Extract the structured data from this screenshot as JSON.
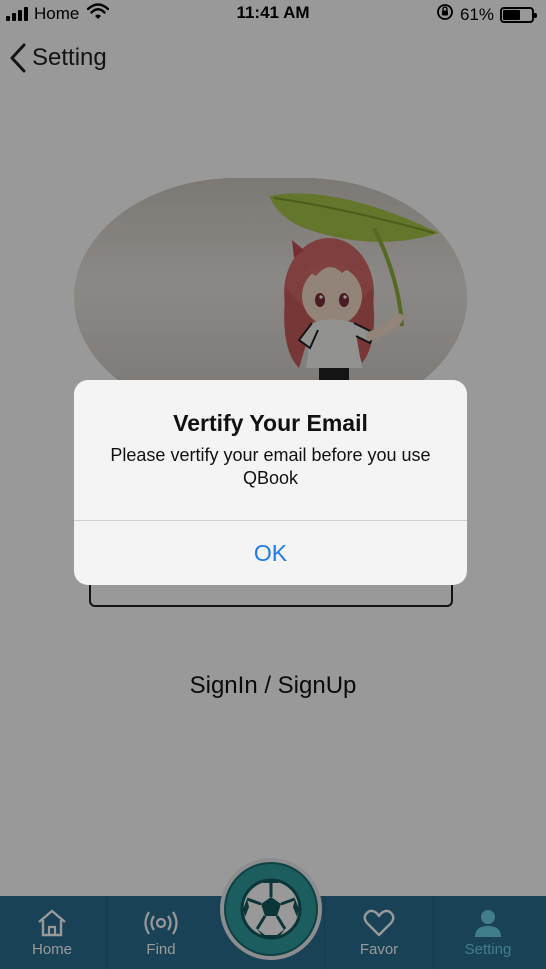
{
  "status_bar": {
    "carrier": "Home",
    "time": "11:41 AM",
    "battery": "61%",
    "battery_level": 0.61,
    "icons": [
      "signal-icon",
      "wifi-icon",
      "rotation-lock-icon",
      "battery-icon"
    ]
  },
  "nav": {
    "back_icon": "chevron-left-icon",
    "title": "Setting"
  },
  "profile": {
    "avatar_image": "figure-holding-leaf-photo",
    "signin_label": "SignIn / SignUp"
  },
  "tab_bar": {
    "background_color": "#2b6e92",
    "active_color": "#6fd0e8",
    "tabs": [
      {
        "label": "Home",
        "icon": "house-icon"
      },
      {
        "label": "Find",
        "icon": "broadcast-icon"
      },
      {
        "label": "",
        "icon": "soccer-ball-icon"
      },
      {
        "label": "Favor",
        "icon": "heart-icon"
      },
      {
        "label": "Setting",
        "icon": "person-icon"
      }
    ]
  },
  "alert": {
    "title": "Vertify Your Email",
    "message": "Please vertify your email before you use QBook",
    "ok_label": "OK",
    "button_color": "#1f7be8"
  }
}
